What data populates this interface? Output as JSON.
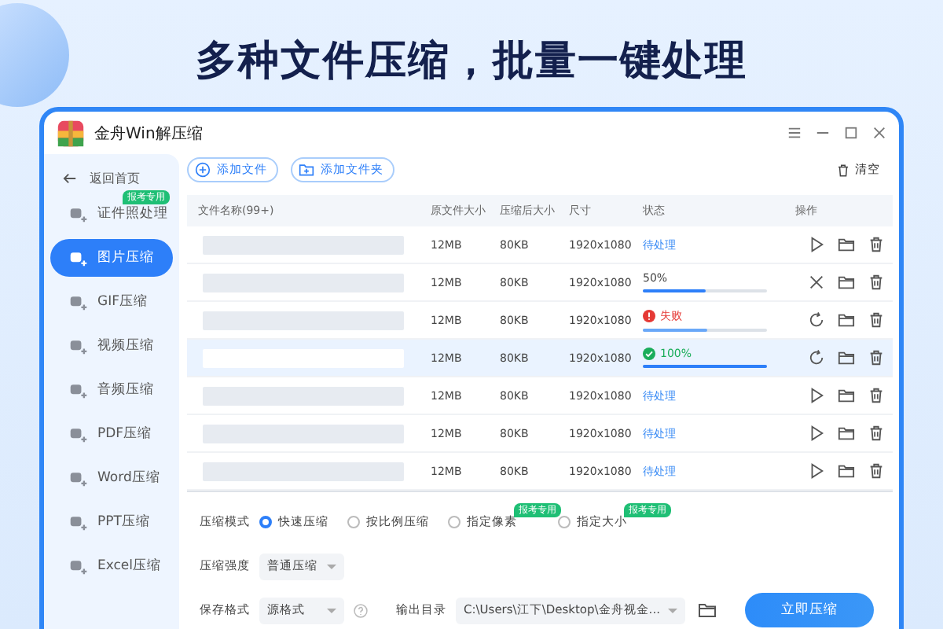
{
  "headline": "多种文件压缩，批量一键处理",
  "window": {
    "title": "金舟Win解压缩"
  },
  "sidebar": {
    "back": "返回首页",
    "items": [
      {
        "label": "证件照处理",
        "badge": "报考专用",
        "selected": false
      },
      {
        "label": "图片压缩",
        "selected": true
      },
      {
        "label": "GIF压缩",
        "selected": false
      },
      {
        "label": "视频压缩",
        "selected": false
      },
      {
        "label": "音频压缩",
        "selected": false
      },
      {
        "label": "PDF压缩",
        "selected": false
      },
      {
        "label": "Word压缩",
        "selected": false
      },
      {
        "label": "PPT压缩",
        "selected": false
      },
      {
        "label": "Excel压缩",
        "selected": false
      }
    ]
  },
  "toolbar": {
    "add_file": "添加文件",
    "add_folder": "添加文件夹",
    "clear": "清空"
  },
  "table": {
    "columns": [
      "文件名称(99+)",
      "原文件大小",
      "压缩后大小",
      "尺寸",
      "状态",
      "操作"
    ],
    "rows": [
      {
        "original": "12MB",
        "compressed": "80KB",
        "dimensions": "1920x1080",
        "kind": "pending",
        "status": "待处理",
        "selected": false
      },
      {
        "original": "12MB",
        "compressed": "80KB",
        "dimensions": "1920x1080",
        "kind": "progress",
        "status": "50%",
        "level": 0.5,
        "selected": false
      },
      {
        "original": "12MB",
        "compressed": "80KB",
        "dimensions": "1920x1080",
        "kind": "failed",
        "status": "失败",
        "level": 0.52,
        "selected": false
      },
      {
        "original": "12MB",
        "compressed": "80KB",
        "dimensions": "1920x1080",
        "kind": "done",
        "status": "100%",
        "level": 1,
        "selected": true
      },
      {
        "original": "12MB",
        "compressed": "80KB",
        "dimensions": "1920x1080",
        "kind": "pending",
        "status": "待处理",
        "selected": false
      },
      {
        "original": "12MB",
        "compressed": "80KB",
        "dimensions": "1920x1080",
        "kind": "pending",
        "status": "待处理",
        "selected": false
      },
      {
        "original": "12MB",
        "compressed": "80KB",
        "dimensions": "1920x1080",
        "kind": "pending",
        "status": "待处理",
        "selected": false
      }
    ]
  },
  "options": {
    "mode_label": "压缩模式",
    "modes": [
      {
        "label": "快速压缩",
        "selected": true
      },
      {
        "label": "按比例压缩",
        "selected": false
      },
      {
        "label": "指定像素",
        "badge": "报考专用",
        "selected": false
      },
      {
        "label": "指定大小",
        "badge": "报考专用",
        "selected": false
      }
    ],
    "strength_label": "压缩强度",
    "strength": "普通压缩",
    "format_label": "保存格式",
    "format": "源格式",
    "output_label": "输出目录",
    "output": "C:\\Users\\江下\\Desktop\\金舟视金...",
    "start": "立即压缩"
  }
}
